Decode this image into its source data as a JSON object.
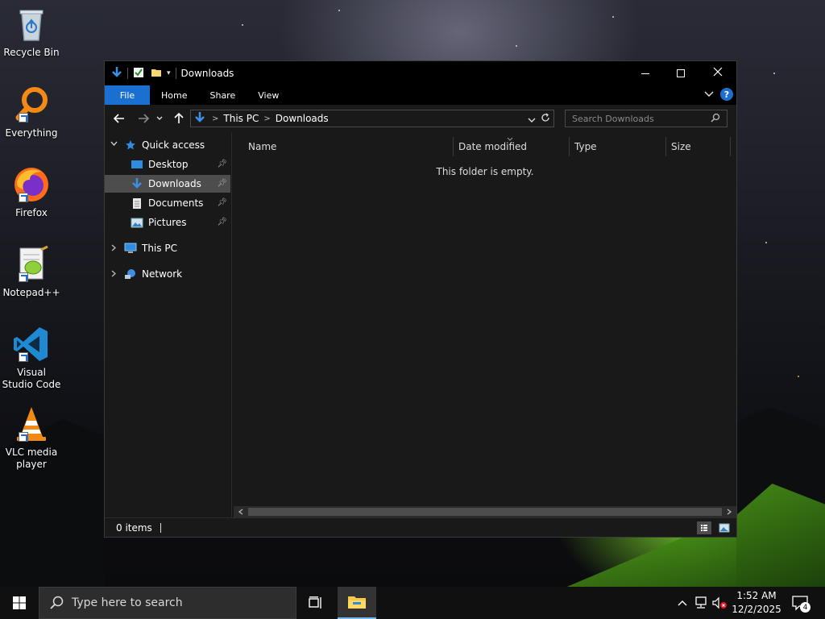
{
  "desktop": {
    "icons": [
      {
        "label": "Recycle Bin",
        "icon": "recycle-bin-icon"
      },
      {
        "label": "Everything",
        "icon": "everything-search-icon"
      },
      {
        "label": "Firefox",
        "icon": "firefox-icon"
      },
      {
        "label": "Notepad++",
        "icon": "notepadpp-icon"
      },
      {
        "label": "Visual Studio Code",
        "icon": "vscode-icon"
      },
      {
        "label": "VLC media player",
        "icon": "vlc-icon"
      }
    ]
  },
  "window": {
    "title": "Downloads",
    "ribbon_tabs": [
      "File",
      "Home",
      "Share",
      "View"
    ],
    "help_label": "?",
    "address": {
      "crumbs": [
        "This PC",
        "Downloads"
      ]
    },
    "search": {
      "placeholder": "Search Downloads"
    },
    "nav_pane": {
      "quick_access": "Quick access",
      "items": [
        "Desktop",
        "Downloads",
        "Documents",
        "Pictures"
      ],
      "selected": "Downloads",
      "this_pc": "This PC",
      "network": "Network"
    },
    "columns": [
      "Name",
      "Date modified",
      "Type",
      "Size"
    ],
    "empty_message": "This folder is empty.",
    "status": {
      "items": "0 items"
    }
  },
  "taskbar": {
    "search_placeholder": "Type here to search",
    "time": "1:52 AM",
    "date": "12/2/2025",
    "notification_count": "4"
  },
  "colors": {
    "accent": "#1a6fd0",
    "window_bg": "#191919",
    "selected_bg": "#4d4d4d",
    "taskbar_bg": "#101010"
  }
}
